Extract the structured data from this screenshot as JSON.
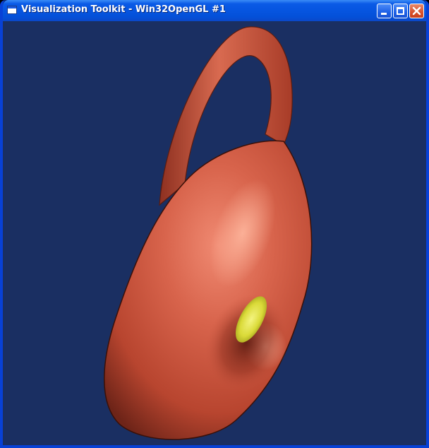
{
  "window": {
    "title": "Visualization Toolkit - Win32OpenGL #1",
    "icons": {
      "app": "window-icon",
      "minimize": "minimize-icon",
      "maximize": "maximize-icon",
      "close": "close-icon"
    }
  },
  "scene": {
    "background_color": "#1a2f62",
    "object": "klein-bottle",
    "surface_color": "#c8563f",
    "inner_surface_color": "#e0e040"
  }
}
